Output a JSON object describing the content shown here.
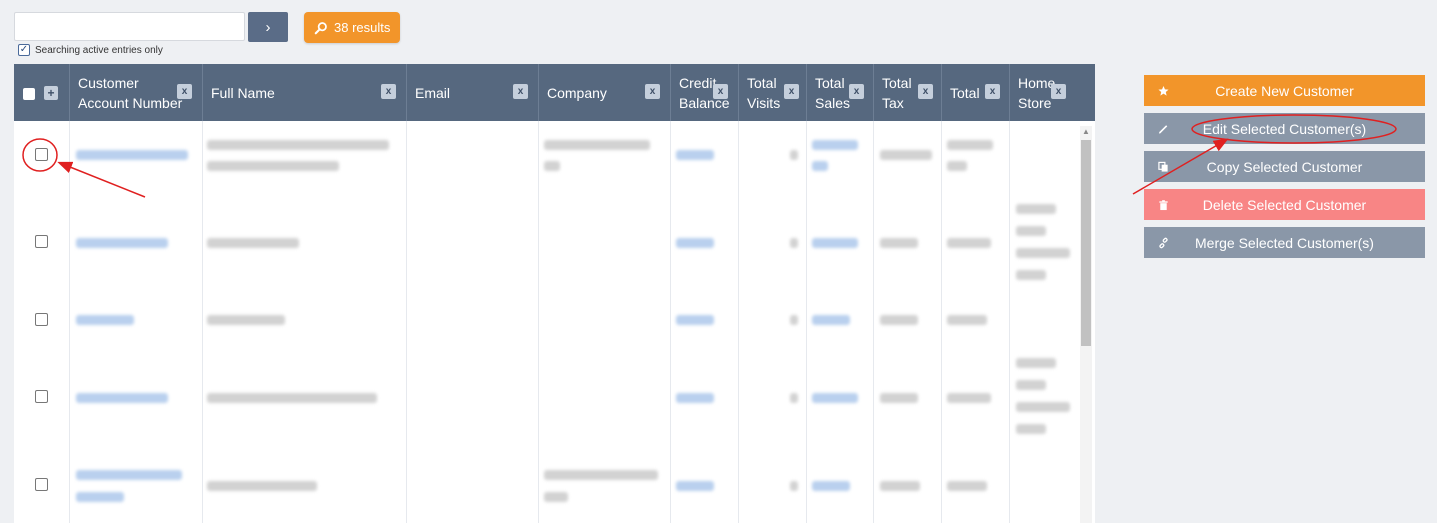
{
  "search": {
    "value": "",
    "go_label": "›"
  },
  "results_badge": {
    "text": "38 results"
  },
  "active_only": {
    "label": "Searching active entries only",
    "checked": true
  },
  "table": {
    "headers": {
      "account": "Customer Account Number",
      "full_name": "Full Name",
      "email": "Email",
      "company": "Company",
      "credit": "Credit Balance",
      "visits": "Total Visits",
      "sales": "Total Sales",
      "tax": "Total Tax",
      "total": "Total",
      "store": "Home Store"
    },
    "remove_label": "x",
    "add_label": "+"
  },
  "actions": {
    "create": "Create New Customer",
    "edit": "Edit Selected Customer(s)",
    "copy": "Copy Selected Customer",
    "delete": "Delete Selected Customer",
    "merge": "Merge Selected Customer(s)"
  },
  "colors": {
    "header_bg": "#56687f",
    "orange": "#f2952a",
    "grey_button": "#8a97a8",
    "delete_red": "#f88585",
    "annotation_red": "#e02020"
  }
}
